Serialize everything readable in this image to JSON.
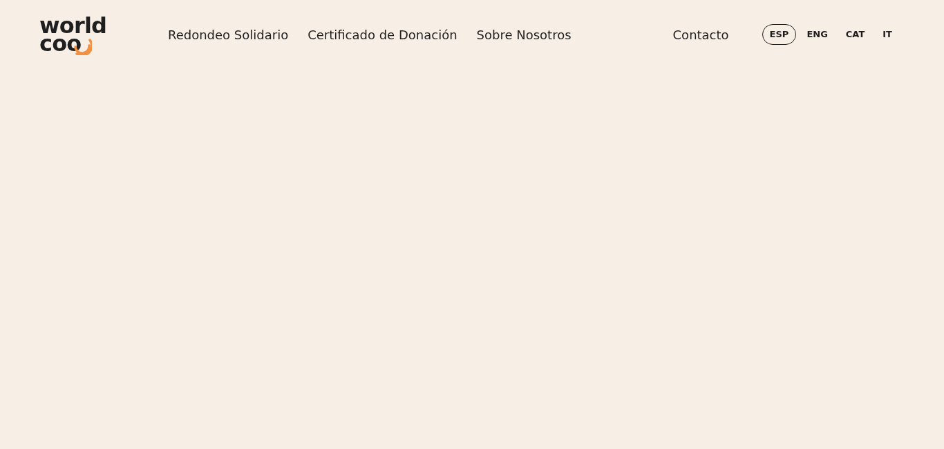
{
  "logo": {
    "line_1": "world",
    "line_2": "coo"
  },
  "nav": [
    "Redondeo Solidario",
    "Certificado de Donación",
    "Sobre Nosotros"
  ],
  "contact": "Contacto",
  "languages": [
    {
      "label": "ESP",
      "selected": true
    },
    {
      "label": "ENG",
      "selected": false
    },
    {
      "label": "CAT",
      "selected": false
    },
    {
      "label": "IT",
      "selected": false
    }
  ]
}
